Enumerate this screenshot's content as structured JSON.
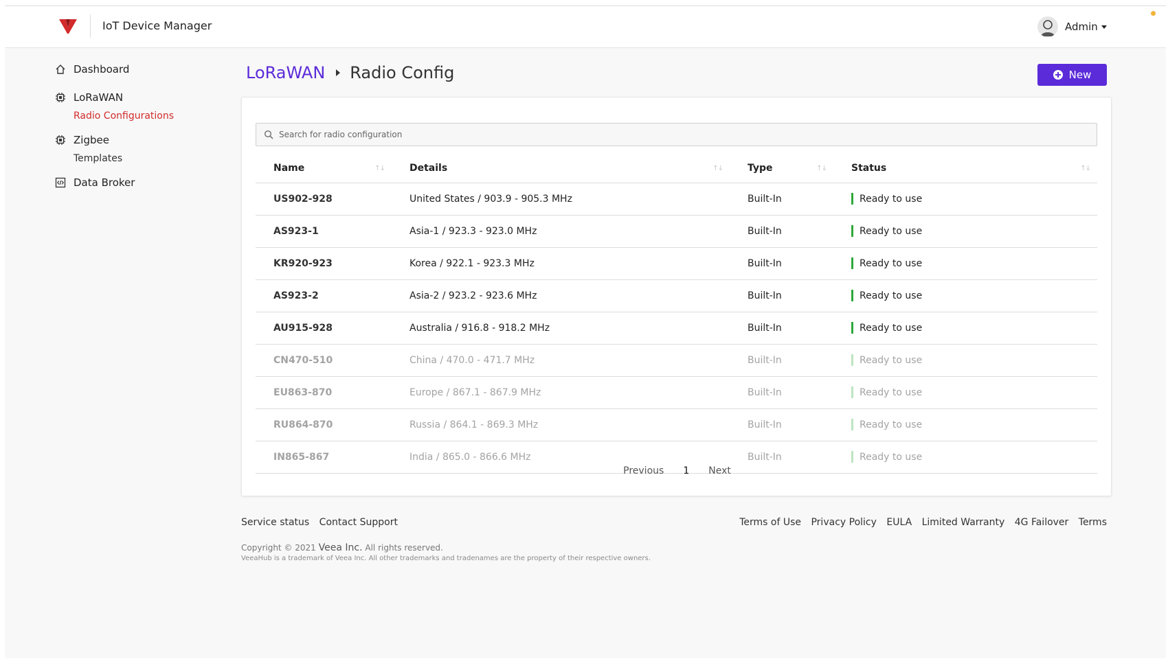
{
  "header": {
    "app_title": "IoT Device Manager",
    "user_name": "Admin",
    "brand_color": "#d22b2b",
    "accent_color": "#5b2bd9"
  },
  "sidebar": {
    "items": [
      {
        "label": "Dashboard",
        "icon": "home-icon"
      },
      {
        "label": "LoRaWAN",
        "icon": "chip-icon",
        "sub": [
          {
            "label": "Radio Configurations",
            "active": true
          }
        ]
      },
      {
        "label": "Zigbee",
        "icon": "chip-icon",
        "sub": [
          {
            "label": "Templates",
            "active": false
          }
        ]
      },
      {
        "label": "Data Broker",
        "icon": "code-icon"
      }
    ]
  },
  "breadcrumb": {
    "parent": "LoRaWAN",
    "current": "Radio Config"
  },
  "toolbar": {
    "new_label": "New"
  },
  "search": {
    "placeholder": "Search for radio configuration",
    "value": ""
  },
  "table": {
    "columns": [
      "Name",
      "Details",
      "Type",
      "Status"
    ],
    "rows": [
      {
        "name": "US902-928",
        "details": "United States / 903.9 - 905.3 MHz",
        "type": "Built-In",
        "status": "Ready to use",
        "dim": false
      },
      {
        "name": "AS923-1",
        "details": "Asia-1 / 923.3 - 923.0 MHz",
        "type": "Built-In",
        "status": "Ready to use",
        "dim": false
      },
      {
        "name": "KR920-923",
        "details": "Korea / 922.1 - 923.3 MHz",
        "type": "Built-In",
        "status": "Ready to use",
        "dim": false
      },
      {
        "name": "AS923-2",
        "details": "Asia-2 / 923.2 - 923.6 MHz",
        "type": "Built-In",
        "status": "Ready to use",
        "dim": false
      },
      {
        "name": "AU915-928",
        "details": "Australia / 916.8 - 918.2 MHz",
        "type": "Built-In",
        "status": "Ready to use",
        "dim": false
      },
      {
        "name": "CN470-510",
        "details": "China / 470.0 - 471.7 MHz",
        "type": "Built-In",
        "status": "Ready to use",
        "dim": true
      },
      {
        "name": "EU863-870",
        "details": "Europe / 867.1 - 867.9 MHz",
        "type": "Built-In",
        "status": "Ready to use",
        "dim": true
      },
      {
        "name": "RU864-870",
        "details": "Russia / 864.1 - 869.3 MHz",
        "type": "Built-In",
        "status": "Ready to use",
        "dim": true
      },
      {
        "name": "IN865-867",
        "details": "India / 865.0 - 866.6 MHz",
        "type": "Built-In",
        "status": "Ready to use",
        "dim": true
      }
    ],
    "status_color": "#2fa83a"
  },
  "pagination": {
    "previous": "Previous",
    "current": "1",
    "next": "Next"
  },
  "footer": {
    "left_links": [
      "Service status",
      "Contact Support"
    ],
    "right_links": [
      "Terms of Use",
      "Privacy Policy",
      "EULA",
      "Limited Warranty",
      "4G Failover",
      "Terms"
    ],
    "copyright_prefix": "Copyright © 2021",
    "company": "Veea Inc.",
    "rights": "All rights reserved.",
    "trademark": "VeeaHub is a trademark of Veea Inc. All other trademarks and tradenames are the property of their respective owners."
  }
}
